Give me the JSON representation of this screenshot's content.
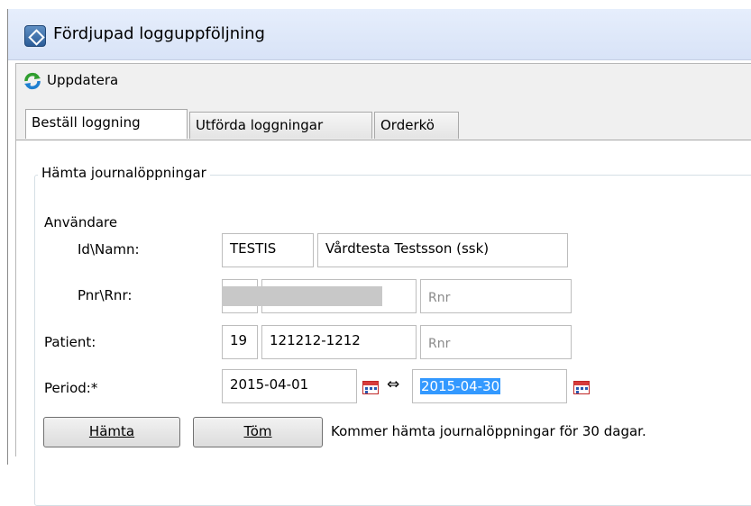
{
  "window": {
    "title": "Fördjupad logguppföljning"
  },
  "toolbar": {
    "refresh_label": "Uppdatera"
  },
  "tabs": [
    {
      "label": "Beställ loggning",
      "active": true
    },
    {
      "label": "Utförda loggningar",
      "active": false
    },
    {
      "label": "Orderkö",
      "active": false
    }
  ],
  "form": {
    "group_title": "Hämta journalöppningar",
    "user_section_label": "Användare",
    "id_name_label": "Id\\Namn:",
    "user_id": "TESTIS",
    "user_name": "Vårdtesta Testsson (ssk)",
    "pnr_rnr_label": "Pnr\\Rnr:",
    "rnr_placeholder": "Rnr",
    "patient_label": "Patient:",
    "patient_century": "19",
    "patient_pnr": "121212-1212",
    "period_label": "Period:*",
    "period_from": "2015-04-01",
    "period_to": "2015-04-30",
    "fetch_button": "Hämta",
    "clear_button": "Töm",
    "status_message": "Kommer hämta journalöppningar för 30 dagar."
  },
  "icons": {
    "app": "app-diamond-icon",
    "refresh": "refresh-icon",
    "calendar": "calendar-icon",
    "range": "double-arrow-icon"
  },
  "colors": {
    "selection": "#3399ff",
    "titlebar": "#dde6f6"
  }
}
